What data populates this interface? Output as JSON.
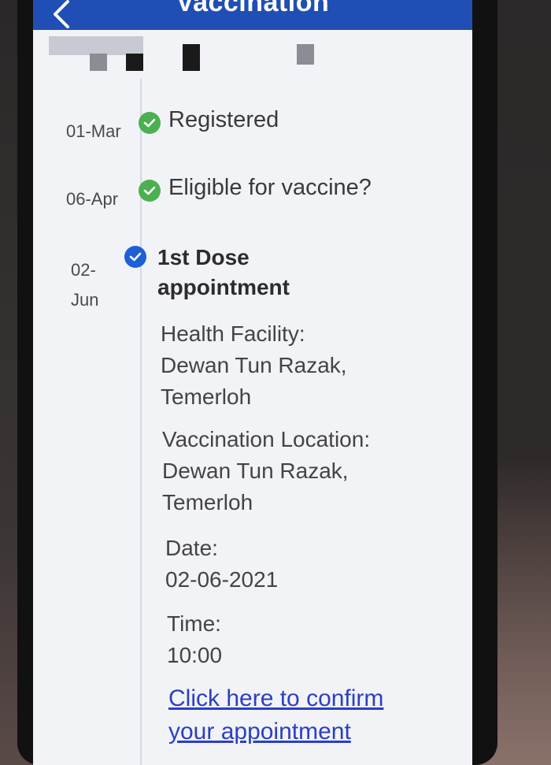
{
  "header": {
    "title": "Vaccination",
    "back_icon": "chevron-left-icon"
  },
  "colors": {
    "header_bg": "#1f4fb4",
    "check_green": "#4caf50",
    "check_blue": "#1e5fd8",
    "link": "#2b3ec7"
  },
  "timeline": {
    "steps": [
      {
        "date": "01-Mar",
        "label": "Registered",
        "status": "completed",
        "icon": "check-circle-icon"
      },
      {
        "date": "06-Apr",
        "label": "Eligible for vaccine?",
        "status": "completed",
        "icon": "check-circle-icon"
      },
      {
        "date_line1": "02-",
        "date_line2": "Jun",
        "title_line1": "1st Dose",
        "title_line2": "appointment",
        "status": "current",
        "icon": "check-circle-icon",
        "facility_label": "Health Facility:",
        "facility_line1": "Dewan Tun Razak,",
        "facility_line2": "Temerloh",
        "location_label": "Vaccination Location:",
        "location_line1": "Dewan Tun Razak,",
        "location_line2": "Temerloh",
        "date_label": "Date:",
        "date_value": "02-06-2021",
        "time_label": "Time:",
        "time_value": "10:00",
        "confirm_line1": "Click here to confirm",
        "confirm_line2": "your appointment"
      }
    ]
  }
}
